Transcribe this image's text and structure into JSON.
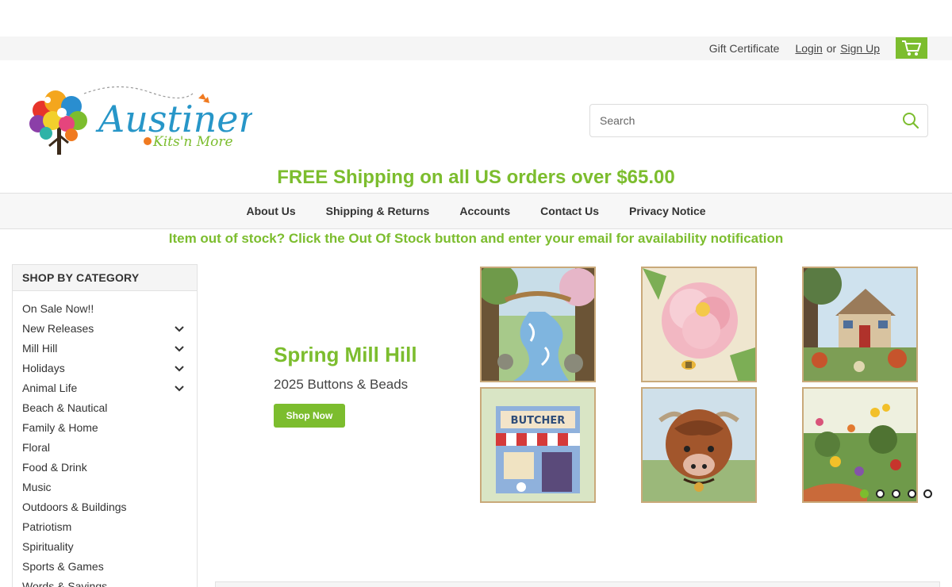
{
  "topbar": {
    "gift_certificate": "Gift Certificate",
    "login": "Login",
    "or": "or",
    "signup": "Sign Up",
    "cart_icon": "cart-icon"
  },
  "brand": {
    "name": "Austiners",
    "tagline": "Kits'n More"
  },
  "search": {
    "placeholder": "Search",
    "icon": "search-icon"
  },
  "promo": {
    "free_shipping": "FREE Shipping on all US orders over $65.00",
    "stock_note": "Item out of stock? Click the Out Of Stock button and enter your email for availability notification"
  },
  "nav": {
    "items": [
      "About Us",
      "Shipping & Returns",
      "Accounts",
      "Contact Us",
      "Privacy Notice"
    ]
  },
  "sidebar": {
    "heading": "SHOP BY CATEGORY",
    "items": [
      {
        "label": "On Sale Now!!",
        "expandable": false
      },
      {
        "label": "New Releases",
        "expandable": true
      },
      {
        "label": "Mill Hill",
        "expandable": true
      },
      {
        "label": "Holidays",
        "expandable": true
      },
      {
        "label": "Animal Life",
        "expandable": true
      },
      {
        "label": "Beach & Nautical",
        "expandable": false
      },
      {
        "label": "Family & Home",
        "expandable": false
      },
      {
        "label": "Floral",
        "expandable": false
      },
      {
        "label": "Food & Drink",
        "expandable": false
      },
      {
        "label": "Music",
        "expandable": false
      },
      {
        "label": "Outdoors & Buildings",
        "expandable": false
      },
      {
        "label": "Patriotism",
        "expandable": false
      },
      {
        "label": "Spirituality",
        "expandable": false
      },
      {
        "label": "Sports & Games",
        "expandable": false
      },
      {
        "label": "Words & Sayings",
        "expandable": false
      }
    ]
  },
  "slide": {
    "title": "Spring Mill Hill",
    "subtitle": "2025 Buttons & Beads",
    "button": "Shop Now",
    "images": [
      "creek-scene",
      "pink-peony",
      "cottage-garden",
      "butcher-shop",
      "highland-cow",
      "wildflower-garden"
    ],
    "dots": 5,
    "active_dot": 0
  },
  "colors": {
    "accent": "#7cbd2e",
    "nav_bg": "#f7f7f7"
  }
}
